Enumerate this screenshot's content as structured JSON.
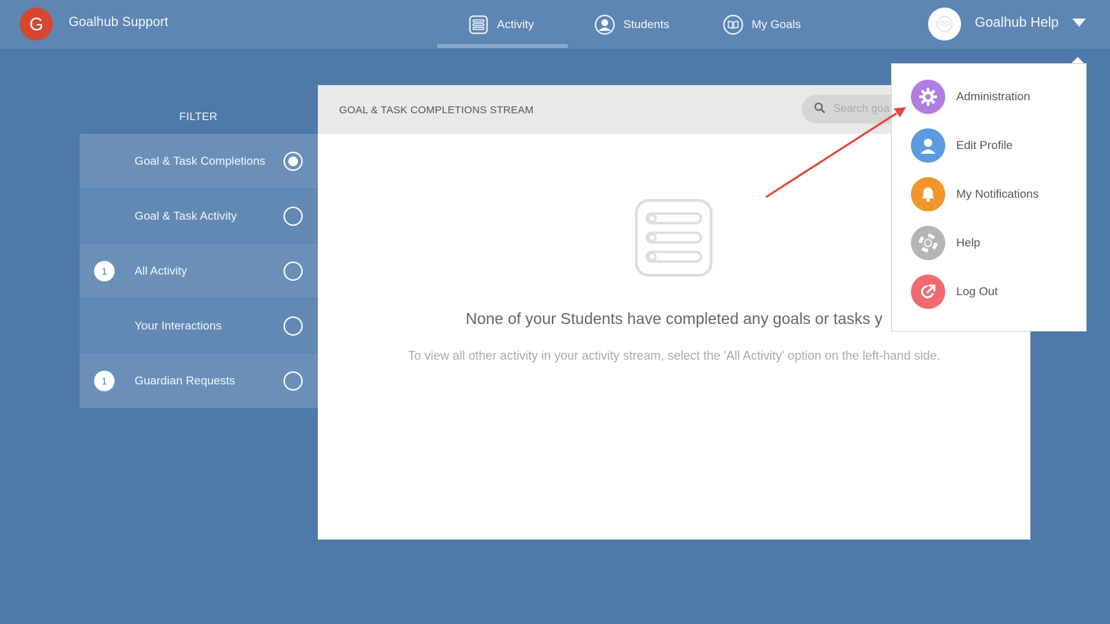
{
  "topbar": {
    "brand_initial": "G",
    "brand_name": "Goalhub Support",
    "nav": [
      {
        "label": "Activity",
        "icon": "activity-list-icon",
        "active": true
      },
      {
        "label": "Students",
        "icon": "student-icon",
        "active": false
      },
      {
        "label": "My Goals",
        "icon": "book-icon",
        "active": false
      }
    ],
    "user_name": "Goalhub Help",
    "user_avatar_icon": "user-avatar-icon",
    "caret_icon": "chevron-down-icon"
  },
  "filter": {
    "title": "FILTER",
    "items": [
      {
        "label": "Goal & Task Completions",
        "badge": "",
        "checked": true
      },
      {
        "label": "Goal & Task Activity",
        "badge": "",
        "checked": false
      },
      {
        "label": "All Activity",
        "badge": "1",
        "checked": false
      },
      {
        "label": "Your Interactions",
        "badge": "",
        "checked": false
      },
      {
        "label": "Guardian Requests",
        "badge": "1",
        "checked": false
      }
    ]
  },
  "panel": {
    "title": "GOAL & TASK COMPLETIONS STREAM",
    "search_placeholder": "Search goa",
    "empty_title": "None of your Students have completed any goals or tasks y",
    "empty_subtitle": "To view all other activity in your activity stream, select the 'All Activity' option on the left-hand side."
  },
  "dropdown": {
    "items": [
      {
        "label": "Administration",
        "icon": "gear-icon",
        "color": "#b07ee0"
      },
      {
        "label": "Edit Profile",
        "icon": "profile-icon",
        "color": "#5b9bdf"
      },
      {
        "label": "My Notifications",
        "icon": "bell-icon",
        "color": "#f0962e"
      },
      {
        "label": "Help",
        "icon": "lifebuoy-icon",
        "color": "#b5b5b5"
      },
      {
        "label": "Log Out",
        "icon": "logout-icon",
        "color": "#ef6b70"
      }
    ]
  },
  "colors": {
    "background": "#4e79a8",
    "topbar": "#5d86b2",
    "brand": "#d5482f",
    "annotation_arrow": "#e0483a"
  }
}
